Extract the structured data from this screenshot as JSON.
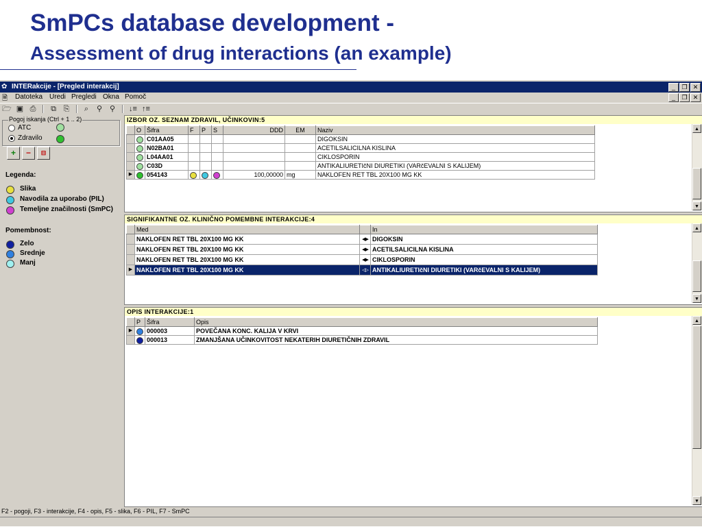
{
  "slide": {
    "title_line1": "SmPCs database development -",
    "title_line2": "Assessment of drug interactions (an example)"
  },
  "colors": {
    "title": "#1f2f8f",
    "titlebar": "#0a246a",
    "section_header": "#ffffc8",
    "dot_yellow": "#e8e040",
    "dot_cyan": "#40c8e0",
    "dot_magenta": "#d040d0",
    "dot_green": "#30c030",
    "dot_lightgreen": "#a0e0a0",
    "severity_high": "#1020a0",
    "severity_mid": "#3080e0",
    "severity_low": "#a0f0f0"
  },
  "window": {
    "title": "INTERakcije - [Pregled interakcij]",
    "menu": [
      "Datoteka",
      "Uredi",
      "Pregledi",
      "Okna",
      "Pomoč"
    ]
  },
  "left": {
    "search_group": "Pogoj iskanja (Ctrl + 1 .. 2)",
    "opt_atc": "ATC",
    "opt_drug": "Zdravilo",
    "legend_title": "Legenda:",
    "legend": [
      "Slika",
      "Navodila za uporabo (PIL)",
      "Temeljne značilnosti (SmPC)"
    ],
    "importance_title": "Pomembnost:",
    "importance": [
      "Zelo",
      "Srednje",
      "Manj"
    ]
  },
  "section1": {
    "title": "IZBOR OZ. SEZNAM ZDRAVIL, UČINKOVIN:5",
    "headers": [
      "O",
      "Šifra",
      "F",
      "P",
      "S",
      "DDD",
      "EM",
      "Naziv"
    ],
    "rows": [
      {
        "code": "C01AA05",
        "ddd": "",
        "em": "",
        "name": "DIGOKSIN"
      },
      {
        "code": "N02BA01",
        "ddd": "",
        "em": "",
        "name": "ACETILSALICILNA KISLINA"
      },
      {
        "code": "L04AA01",
        "ddd": "",
        "em": "",
        "name": "CIKLOSPORIN"
      },
      {
        "code": "C03D",
        "ddd": "",
        "em": "",
        "name": "ANTIKALIURETIčNI DIURETIKI (VARčEVALNI S KALIJEM)"
      },
      {
        "code": "054143",
        "ddd": "100,00000",
        "em": "mg",
        "name": "NAKLOFEN RET TBL 20X100 MG KK"
      }
    ]
  },
  "section2": {
    "title": "SIGNIFIKANTNE OZ. KLINIČNO POMEMBNE INTERAKCIJE:4",
    "headers": [
      "Med",
      "In"
    ],
    "rows": [
      {
        "med": "NAKLOFEN RET TBL 20X100 MG KK",
        "in": "DIGOKSIN"
      },
      {
        "med": "NAKLOFEN RET TBL 20X100 MG KK",
        "in": "ACETILSALICILNA KISLINA"
      },
      {
        "med": "NAKLOFEN RET TBL 20X100 MG KK",
        "in": "CIKLOSPORIN"
      },
      {
        "med": "NAKLOFEN RET TBL 20X100 MG KK",
        "in": "ANTIKALIURETIčNI DIURETIKI (VARčEVALNI S KALIJEM)"
      }
    ]
  },
  "section3": {
    "title": "OPIS INTERAKCIJE:1",
    "headers": [
      "P",
      "Šifra",
      "Opis"
    ],
    "rows": [
      {
        "code": "000003",
        "desc": "POVEČANA KONC. KALIJA V KRVI"
      },
      {
        "code": "000013",
        "desc": "ZMANJŠANA UČINKOVITOST NEKATERIH DIURETIČNIH ZDRAVIL"
      }
    ]
  },
  "statusbar": "F2 - pogoji, F3 - interakcije, F4 - opis, F5 - slika, F6 - PIL, F7 - SmPC"
}
